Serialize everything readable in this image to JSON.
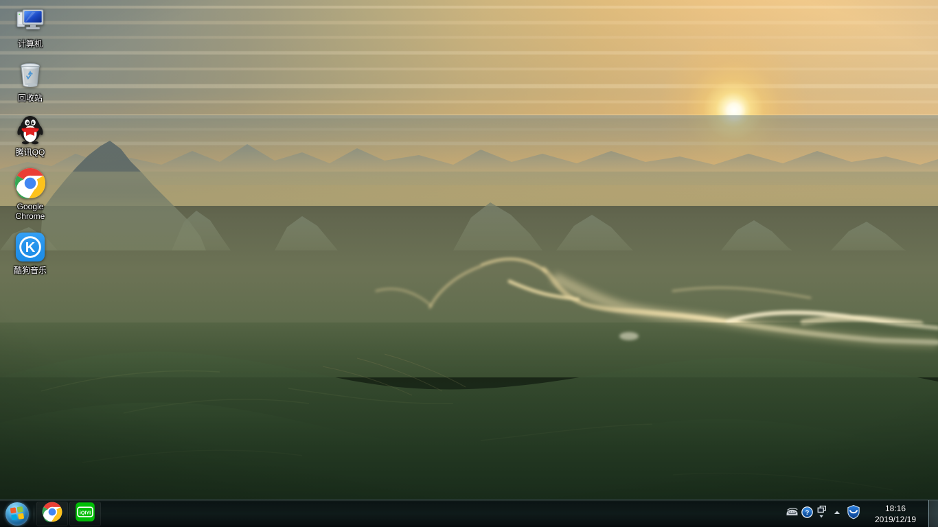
{
  "desktop": {
    "wallpaper_description": "Aerial sunset view over misty mountain valleys with a glowing golden river",
    "colors": {
      "sky_warm": "#f0c383",
      "sky_cool": "#7d8b8c",
      "sun": "#fffbe6",
      "river_glow": "#f5dda0",
      "foreground_green": "#2c4a2a",
      "taskbar": "#0b1416",
      "icon_label": "#ffffff"
    },
    "icons": [
      {
        "label": "计算机",
        "icon_name": "computer-icon"
      },
      {
        "label": "回收站",
        "icon_name": "recycle-bin-icon"
      },
      {
        "label": "腾讯QQ",
        "icon_name": "tencent-qq-penguin-icon"
      },
      {
        "label": "Google Chrome",
        "icon_name": "google-chrome-icon"
      },
      {
        "label": "酷狗音乐",
        "icon_name": "kugou-music-icon"
      }
    ]
  },
  "taskbar": {
    "start_button": {
      "label": "开始",
      "icon_name": "windows-start-orb-icon"
    },
    "quick_launch": [
      {
        "label": "Google Chrome",
        "icon_name": "google-chrome-icon"
      },
      {
        "label": "爱奇艺",
        "icon_name": "iqiyi-icon",
        "badge_text": "iQIYI"
      }
    ],
    "tray": [
      {
        "label": "输入法",
        "icon_name": "ime-keyboard-icon"
      },
      {
        "label": "帮助",
        "icon_name": "help-question-icon"
      },
      {
        "label": "网络/窗口",
        "icon_name": "window-stack-icon"
      },
      {
        "label": "显示隐藏的图标",
        "icon_name": "show-hidden-icons-chevron-up-icon"
      },
      {
        "label": "360安全卫士",
        "icon_name": "security-shield-icon"
      }
    ],
    "clock": {
      "time": "18:16",
      "date": "2019/12/19"
    },
    "show_desktop": {
      "label": "显示桌面",
      "icon_name": "show-desktop-bar-icon"
    }
  }
}
